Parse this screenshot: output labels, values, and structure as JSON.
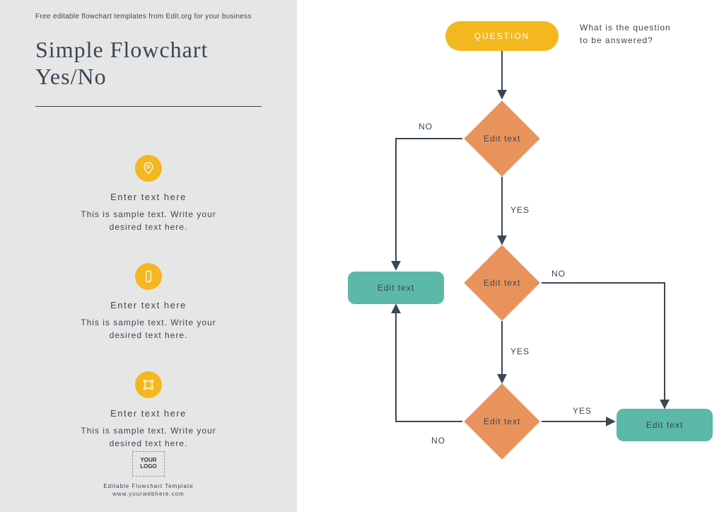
{
  "tagline": "Free editable flowchart templates from Edit.org for your business",
  "title_l1": "Simple Flowchart",
  "title_l2": "Yes/No",
  "features": [
    {
      "title": "Enter text here",
      "desc_l1": "This is sample text. Write your",
      "desc_l2": "desired text here."
    },
    {
      "title": "Enter text here",
      "desc_l1": "This is sample text. Write your",
      "desc_l2": "desired text here."
    },
    {
      "title": "Enter text here",
      "desc_l1": "This is sample text. Write your",
      "desc_l2": "desired text here."
    }
  ],
  "logo": "YOUR LOGO",
  "footer_l1": "Editable Flowchart Template",
  "footer_l2": "www.yourwebhere.com",
  "flow": {
    "start": "QUESTION",
    "annotation": "What is the question to be answered?",
    "d1": "Edit text",
    "d2": "Edit text",
    "d3": "Edit text",
    "box1": "Edit text",
    "box2": "Edit text",
    "yes": "YES",
    "no": "NO"
  },
  "colors": {
    "accent_yellow": "#f3b81f",
    "accent_orange": "#e8935c",
    "accent_teal": "#5cb8a7",
    "ink": "#3a4754",
    "sidebar_bg": "#e6e6e6"
  }
}
